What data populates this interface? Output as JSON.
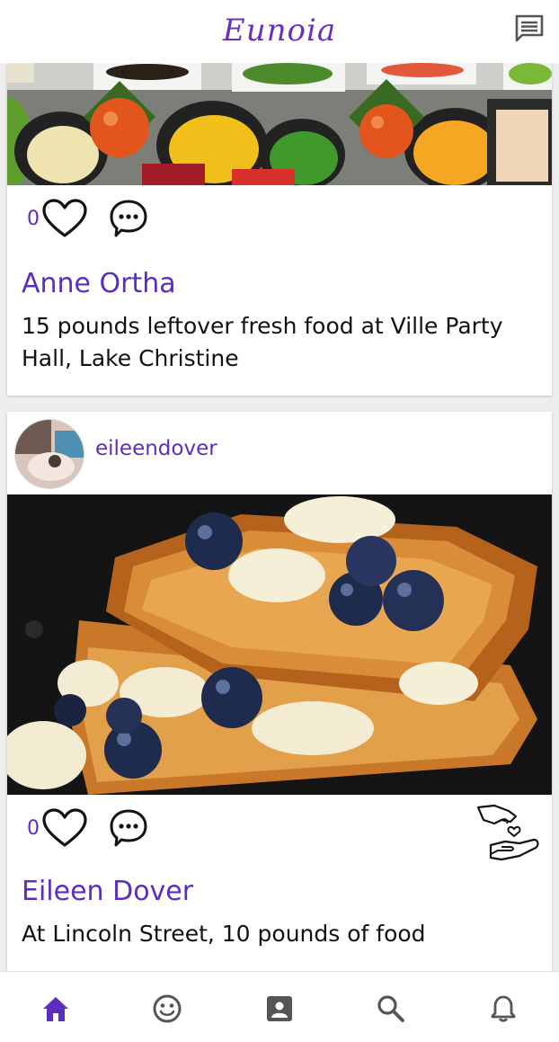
{
  "app": {
    "title": "Eunoia"
  },
  "colors": {
    "accent": "#5b2ebd",
    "nav_active": "#5b2ebd",
    "nav_inactive": "#555555"
  },
  "posts": [
    {
      "likes": "0",
      "name": "Anne Ortha",
      "description": "15 pounds leftover fresh food at Ville Party Hall, Lake Christine",
      "image": "vegetable platters with tomatoes, broccoli, corn and peppers"
    },
    {
      "username": "eileendover",
      "likes": "0",
      "name": "Eileen Dover",
      "description": "At Lincoln Street, 10 pounds of food",
      "image": "french toast with blueberries and banana slices"
    }
  ],
  "nav": {
    "items": [
      {
        "icon": "home-icon",
        "active": true
      },
      {
        "icon": "smiley-icon",
        "active": false
      },
      {
        "icon": "contact-card-icon",
        "active": false
      },
      {
        "icon": "search-icon",
        "active": false
      },
      {
        "icon": "bell-icon",
        "active": false
      }
    ]
  }
}
